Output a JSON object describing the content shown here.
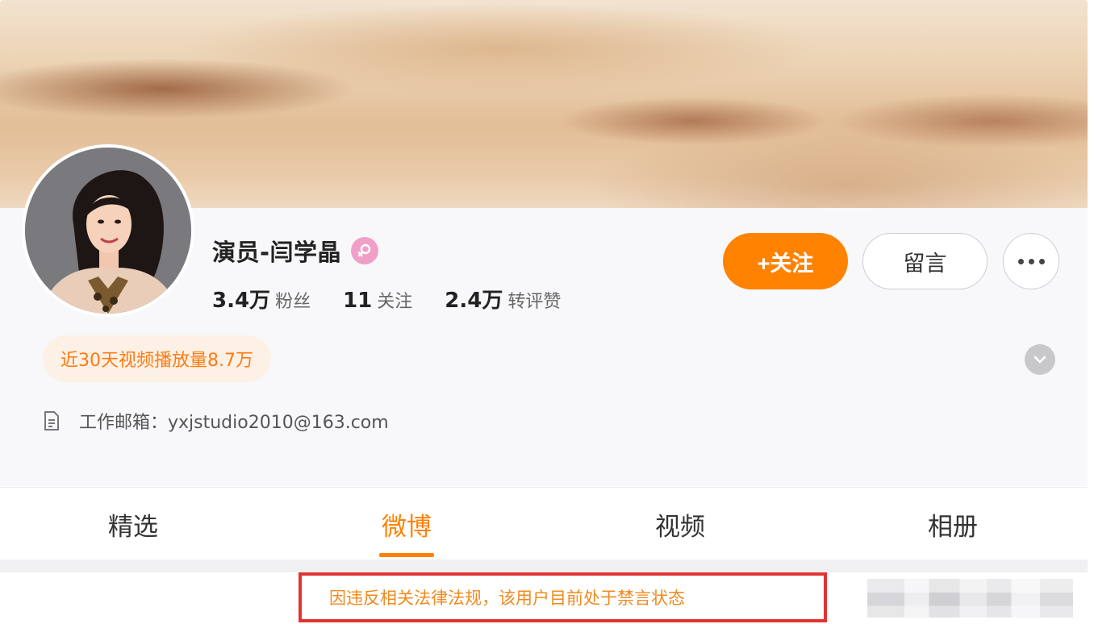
{
  "profile": {
    "name": "演员-闫学晶",
    "stats": [
      {
        "num": "3.4万",
        "label": "粉丝"
      },
      {
        "num": "11",
        "label": "关注"
      },
      {
        "num": "2.4万",
        "label": "转评赞"
      }
    ],
    "play_tag": "近30天视频播放量8.7万",
    "email": "工作邮箱：yxjstudio2010@163.com"
  },
  "actions": {
    "follow_label": "+关注",
    "message_label": "留言"
  },
  "tabs": [
    {
      "label": "精选",
      "active": false
    },
    {
      "label": "微博",
      "active": true
    },
    {
      "label": "视频",
      "active": false
    },
    {
      "label": "相册",
      "active": false
    }
  ],
  "notice": {
    "ban_text": "因违反相关法律法规，该用户目前处于禁言状态"
  },
  "colors": {
    "accent": "#ff8200",
    "notice_border": "#e23333",
    "notice_text": "#f08a1e",
    "play_tag_bg": "#fdf1e6"
  },
  "icons": [
    "female-icon",
    "more-icon",
    "chevron-down-icon",
    "document-icon"
  ]
}
